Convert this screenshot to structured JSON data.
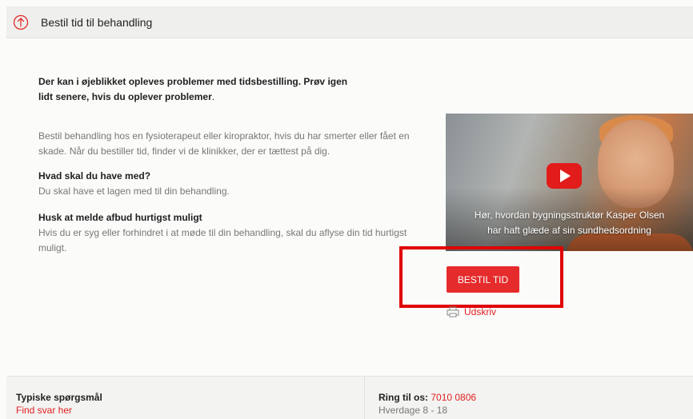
{
  "header": {
    "title": "Bestil tid til behandling",
    "icon": "arrow-up-circle-icon"
  },
  "notice": {
    "text": "Der kan i øjeblikket opleves problemer med tidsbestilling. Prøv igen lidt senere, hvis du oplever problemer",
    "period": "."
  },
  "intro": "Bestil behandling hos en fysioterapeut eller kiropraktor, hvis du har smerter eller fået en skade. Når du bestiller tid, finder vi de klinikker, der er tættest på dig.",
  "sections": [
    {
      "heading": "Hvad skal du have med?",
      "text": "Du skal have et lagen med til din behandling."
    },
    {
      "heading": "Husk at melde afbud hurtigst muligt",
      "text": "Hvis du er syg eller forhindret i at møde til din behandling, skal du aflyse din tid hurtigst muligt."
    }
  ],
  "video": {
    "caption_line1": "Hør, hvordan bygningsstruktør Kasper Olsen",
    "caption_line2": "har haft glæde af sin sundhedsordning",
    "play_icon": "play-icon"
  },
  "actions": {
    "book_label": "BESTIL TID",
    "print_label": "Udskriv",
    "print_icon": "printer-icon"
  },
  "footer": {
    "faq_title": "Typiske spørgsmål",
    "faq_link": "Find svar her",
    "call_label": "Ring til os:",
    "phone": "7010 0806",
    "hours": "Hverdage 8 - 18"
  },
  "colors": {
    "accent": "#e52b2b",
    "highlight": "#e00000",
    "header_bg": "#efefed"
  }
}
